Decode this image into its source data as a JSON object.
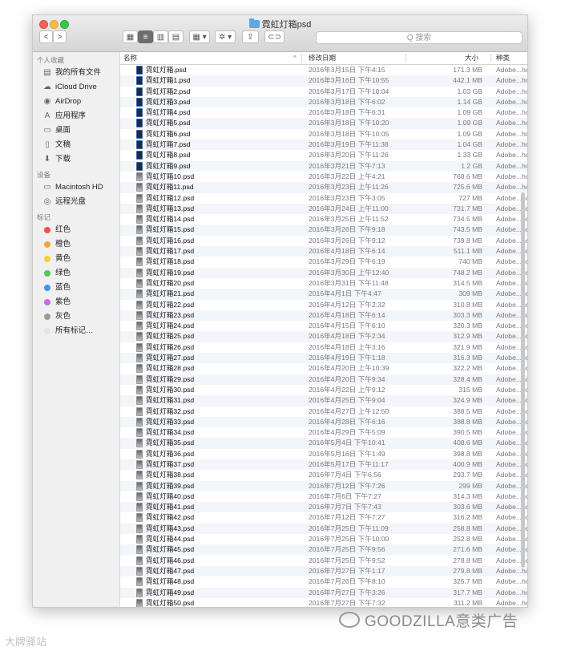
{
  "window": {
    "title": "霓虹灯箱psd"
  },
  "toolbar": {
    "back_label": "<",
    "forward_label": ">",
    "view_icons": "▦",
    "view_list": "≡",
    "view_columns": "▥",
    "view_cover": "▤",
    "arrange_label": "▦ ▾",
    "action_label": "✲ ▾",
    "share_label": "⇪",
    "tag_label": "⊂⊃",
    "search_placeholder": "Q 搜索"
  },
  "sidebar": {
    "favorites_title": "个人收藏",
    "favorites": [
      {
        "label": "我的所有文件",
        "icon": "▤"
      },
      {
        "label": "iCloud Drive",
        "icon": "☁"
      },
      {
        "label": "AirDrop",
        "icon": "◉"
      },
      {
        "label": "应用程序",
        "icon": "A"
      },
      {
        "label": "桌面",
        "icon": "▭"
      },
      {
        "label": "文稿",
        "icon": "▯"
      },
      {
        "label": "下载",
        "icon": "⬇"
      }
    ],
    "devices_title": "设备",
    "devices": [
      {
        "label": "Macintosh HD",
        "icon": "▭"
      },
      {
        "label": "远程光盘",
        "icon": "◎"
      }
    ],
    "tags_title": "标记",
    "tags": [
      {
        "label": "红色",
        "color": "#f0514d"
      },
      {
        "label": "橙色",
        "color": "#f7a13b"
      },
      {
        "label": "黄色",
        "color": "#f6cd3a"
      },
      {
        "label": "绿色",
        "color": "#5bc751"
      },
      {
        "label": "蓝色",
        "color": "#3b97f6"
      },
      {
        "label": "紫色",
        "color": "#c46fd8"
      },
      {
        "label": "灰色",
        "color": "#9a9a9a"
      },
      {
        "label": "所有标记…",
        "color": "#e4e4e4"
      }
    ]
  },
  "columns": {
    "name": "名称",
    "date": "修改日期",
    "size": "大小",
    "kind": "种类",
    "sort_indicator": "^"
  },
  "files": [
    {
      "name": "霓虹灯箱.psd",
      "date": "2016年3月15日 下午4:15",
      "size": "171.3 MB",
      "kind": "Adobe...hop file",
      "icon": "ps"
    },
    {
      "name": "霓虹灯箱1.psd",
      "date": "2016年3月16日 下午10:55",
      "size": "442.1 MB",
      "kind": "Adobe...hop file",
      "icon": "ps"
    },
    {
      "name": "霓虹灯箱2.psd",
      "date": "2016年3月17日 下午10:04",
      "size": "1.03 GB",
      "kind": "Adobe...hop file",
      "icon": "ps"
    },
    {
      "name": "霓虹灯箱3.psd",
      "date": "2016年3月18日 下午6:02",
      "size": "1.14 GB",
      "kind": "Adobe...hop file",
      "icon": "ps"
    },
    {
      "name": "霓虹灯箱4.psd",
      "date": "2016年3月18日 下午6:31",
      "size": "1.09 GB",
      "kind": "Adobe...hop file",
      "icon": "ps"
    },
    {
      "name": "霓虹灯箱5.psd",
      "date": "2016年3月18日 下午10:20",
      "size": "1.09 GB",
      "kind": "Adobe...hop file",
      "icon": "ps"
    },
    {
      "name": "霓虹灯箱6.psd",
      "date": "2016年3月18日 下午10:05",
      "size": "1.09 GB",
      "kind": "Adobe...hop file",
      "icon": "ps"
    },
    {
      "name": "霓虹灯箱7.psd",
      "date": "2016年3月19日 下午11:38",
      "size": "1.04 GB",
      "kind": "Adobe...hop file",
      "icon": "ps"
    },
    {
      "name": "霓虹灯箱8.psd",
      "date": "2016年3月20日 下午11:26",
      "size": "1.33 GB",
      "kind": "Adobe...hop file",
      "icon": "ps"
    },
    {
      "name": "霓虹灯箱9.psd",
      "date": "2016年3月21日 下午7:13",
      "size": "1.2 GB",
      "kind": "Adobe...hop file",
      "icon": "ps"
    },
    {
      "name": "霓虹灯箱10.psd",
      "date": "2016年3月22日 上午4:21",
      "size": "768.6 MB",
      "kind": "Adobe...hop file",
      "icon": "pic"
    },
    {
      "name": "霓虹灯箱11.psd",
      "date": "2016年3月23日 上午11:26",
      "size": "725.6 MB",
      "kind": "Adobe...hop file",
      "icon": "pic"
    },
    {
      "name": "霓虹灯箱12.psd",
      "date": "2016年3月23日 下午3:05",
      "size": "727 MB",
      "kind": "Adobe...hop file",
      "icon": "pic"
    },
    {
      "name": "霓虹灯箱13.psd",
      "date": "2016年3月24日 上午11:00",
      "size": "731.7 MB",
      "kind": "Adobe...hop file",
      "icon": "pic"
    },
    {
      "name": "霓虹灯箱14.psd",
      "date": "2016年3月25日 上午11:52",
      "size": "734.5 MB",
      "kind": "Adobe...hop file",
      "icon": "pic"
    },
    {
      "name": "霓虹灯箱15.psd",
      "date": "2016年3月26日 下午9:18",
      "size": "743.5 MB",
      "kind": "Adobe...hop file",
      "icon": "pic"
    },
    {
      "name": "霓虹灯箱16.psd",
      "date": "2016年3月26日 下午9:12",
      "size": "739.8 MB",
      "kind": "Adobe...hop file",
      "icon": "pic"
    },
    {
      "name": "霓虹灯箱17.psd",
      "date": "2016年4月18日 下午6:14",
      "size": "511.1 MB",
      "kind": "Adobe...hop file",
      "icon": "pic"
    },
    {
      "name": "霓虹灯箱18.psd",
      "date": "2016年3月29日 下午6:19",
      "size": "740 MB",
      "kind": "Adobe...hop file",
      "icon": "pic"
    },
    {
      "name": "霓虹灯箱19.psd",
      "date": "2016年3月30日 上午12:40",
      "size": "748.2 MB",
      "kind": "Adobe...hop file",
      "icon": "pic"
    },
    {
      "name": "霓虹灯箱20.psd",
      "date": "2016年3月31日 下午11:48",
      "size": "314.5 MB",
      "kind": "Adobe...hop file",
      "icon": "pic"
    },
    {
      "name": "霓虹灯箱21.psd",
      "date": "2016年4月1日 下午4:47",
      "size": "309 MB",
      "kind": "Adobe...hop file",
      "icon": "pic"
    },
    {
      "name": "霓虹灯箱22.psd",
      "date": "2016年4月12日 下午2:32",
      "size": "310.8 MB",
      "kind": "Adobe...hop file",
      "icon": "pic"
    },
    {
      "name": "霓虹灯箱23.psd",
      "date": "2016年4月18日 下午6:14",
      "size": "303.3 MB",
      "kind": "Adobe...hop file",
      "icon": "pic"
    },
    {
      "name": "霓虹灯箱24.psd",
      "date": "2016年4月15日 下午6:10",
      "size": "320.3 MB",
      "kind": "Adobe...hop file",
      "icon": "pic"
    },
    {
      "name": "霓虹灯箱25.psd",
      "date": "2016年4月18日 下午2:34",
      "size": "312.9 MB",
      "kind": "Adobe...hop file",
      "icon": "pic"
    },
    {
      "name": "霓虹灯箱26.psd",
      "date": "2016年4月18日 上午3:16",
      "size": "321.9 MB",
      "kind": "Adobe...hop file",
      "icon": "pic"
    },
    {
      "name": "霓虹灯箱27.psd",
      "date": "2016年4月19日 下午1:18",
      "size": "316.3 MB",
      "kind": "Adobe...hop file",
      "icon": "pic"
    },
    {
      "name": "霓虹灯箱28.psd",
      "date": "2016年4月20日 上午10:39",
      "size": "322.2 MB",
      "kind": "Adobe...hop file",
      "icon": "pic"
    },
    {
      "name": "霓虹灯箱29.psd",
      "date": "2016年4月20日 下午9:34",
      "size": "328.4 MB",
      "kind": "Adobe...hop file",
      "icon": "pic"
    },
    {
      "name": "霓虹灯箱30.psd",
      "date": "2016年4月22日 上午9:12",
      "size": "315 MB",
      "kind": "Adobe...hop file",
      "icon": "pic"
    },
    {
      "name": "霓虹灯箱31.psd",
      "date": "2016年4月25日 下午9:04",
      "size": "324.9 MB",
      "kind": "Adobe...hop file",
      "icon": "pic"
    },
    {
      "name": "霓虹灯箱32.psd",
      "date": "2016年4月27日 上午12:50",
      "size": "388.5 MB",
      "kind": "Adobe...hop file",
      "icon": "pic"
    },
    {
      "name": "霓虹灯箱33.psd",
      "date": "2016年4月28日 下午6:16",
      "size": "388.8 MB",
      "kind": "Adobe...hop file",
      "icon": "pic"
    },
    {
      "name": "霓虹灯箱34.psd",
      "date": "2016年4月29日 下午5:09",
      "size": "390.5 MB",
      "kind": "Adobe...hop file",
      "icon": "pic"
    },
    {
      "name": "霓虹灯箱35.psd",
      "date": "2016年5月4日 下午10:41",
      "size": "408.6 MB",
      "kind": "Adobe...hop file",
      "icon": "pic"
    },
    {
      "name": "霓虹灯箱36.psd",
      "date": "2016年5月16日 下午1:49",
      "size": "398.8 MB",
      "kind": "Adobe...hop file",
      "icon": "pic"
    },
    {
      "name": "霓虹灯箱37.psd",
      "date": "2016年5月17日 下午11:17",
      "size": "400.9 MB",
      "kind": "Adobe...hop file",
      "icon": "pic"
    },
    {
      "name": "霓虹灯箱38.psd",
      "date": "2016年7月4日 下午6:56",
      "size": "293.7 MB",
      "kind": "Adobe...hop file",
      "icon": "pic"
    },
    {
      "name": "霓虹灯箱39.psd",
      "date": "2016年7月12日 下午7:26",
      "size": "299 MB",
      "kind": "Adobe...hop file",
      "icon": "pic"
    },
    {
      "name": "霓虹灯箱40.psd",
      "date": "2016年7月6日 下午7:27",
      "size": "314.3 MB",
      "kind": "Adobe...hop file",
      "icon": "pic"
    },
    {
      "name": "霓虹灯箱41.psd",
      "date": "2016年7月7日 下午7:43",
      "size": "303.6 MB",
      "kind": "Adobe...hop file",
      "icon": "pic"
    },
    {
      "name": "霓虹灯箱42.psd",
      "date": "2016年7月12日 下午7:27",
      "size": "316.2 MB",
      "kind": "Adobe...hop file",
      "icon": "pic"
    },
    {
      "name": "霓虹灯箱43.psd",
      "date": "2016年7月25日 下午11:09",
      "size": "258.8 MB",
      "kind": "Adobe...hop file",
      "icon": "pic"
    },
    {
      "name": "霓虹灯箱44.psd",
      "date": "2016年7月25日 下午10:00",
      "size": "252.8 MB",
      "kind": "Adobe...hop file",
      "icon": "pic"
    },
    {
      "name": "霓虹灯箱45.psd",
      "date": "2016年7月25日 下午9:56",
      "size": "271.6 MB",
      "kind": "Adobe...hop file",
      "icon": "pic"
    },
    {
      "name": "霓虹灯箱46.psd",
      "date": "2016年7月25日 下午9:52",
      "size": "278.8 MB",
      "kind": "Adobe...hop file",
      "icon": "pic"
    },
    {
      "name": "霓虹灯箱47.psd",
      "date": "2016年7月27日 下午1:17",
      "size": "279.8 MB",
      "kind": "Adobe...hop file",
      "icon": "pic"
    },
    {
      "name": "霓虹灯箱48.psd",
      "date": "2016年7月26日 下午8:10",
      "size": "325.7 MB",
      "kind": "Adobe...hop file",
      "icon": "pic"
    },
    {
      "name": "霓虹灯箱49.psd",
      "date": "2016年7月27日 下午3:26",
      "size": "317.7 MB",
      "kind": "Adobe...hop file",
      "icon": "pic"
    },
    {
      "name": "霓虹灯箱50.psd",
      "date": "2016年7月27日 下午7:32",
      "size": "311.2 MB",
      "kind": "Adobe...hop file",
      "icon": "pic"
    }
  ],
  "watermark": {
    "main": "GOODZILLA意类广告",
    "secondary": "大牌驿站"
  }
}
